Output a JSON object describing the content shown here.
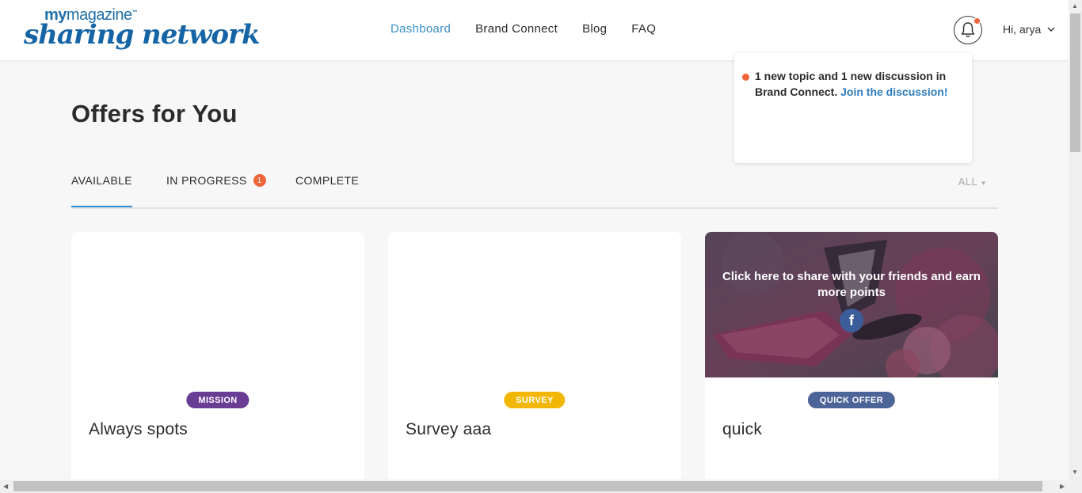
{
  "logo": {
    "top_bold": "my",
    "top_light": "magazine",
    "bottom": "sharing network"
  },
  "nav": {
    "items": [
      "Dashboard",
      "Brand Connect",
      "Blog",
      "FAQ"
    ]
  },
  "user": {
    "greeting": "Hi, arya"
  },
  "notification": {
    "text": "1 new topic and 1 new discussion in Brand Connect.",
    "link": "Join the discussion!"
  },
  "page": {
    "title": "Offers for You"
  },
  "tabs": {
    "available": "AVAILABLE",
    "in_progress": "IN PROGRESS",
    "in_progress_count": "1",
    "complete": "COMPLETE",
    "filter": "ALL"
  },
  "cards": [
    {
      "tag": "MISSION",
      "tag_color": "#6a3d94",
      "title": "Always spots"
    },
    {
      "tag": "SURVEY",
      "tag_color": "#f2b705",
      "title": "Survey aaa"
    },
    {
      "tag": "QUICK OFFER",
      "tag_color": "#4c6497",
      "title": "quick",
      "share_text": "Click here to share with your friends and earn more points",
      "share_icon": "f"
    }
  ],
  "colors": {
    "accent": "#2f8ed2",
    "badge": "#f0643a",
    "brand": "#1565a6"
  }
}
